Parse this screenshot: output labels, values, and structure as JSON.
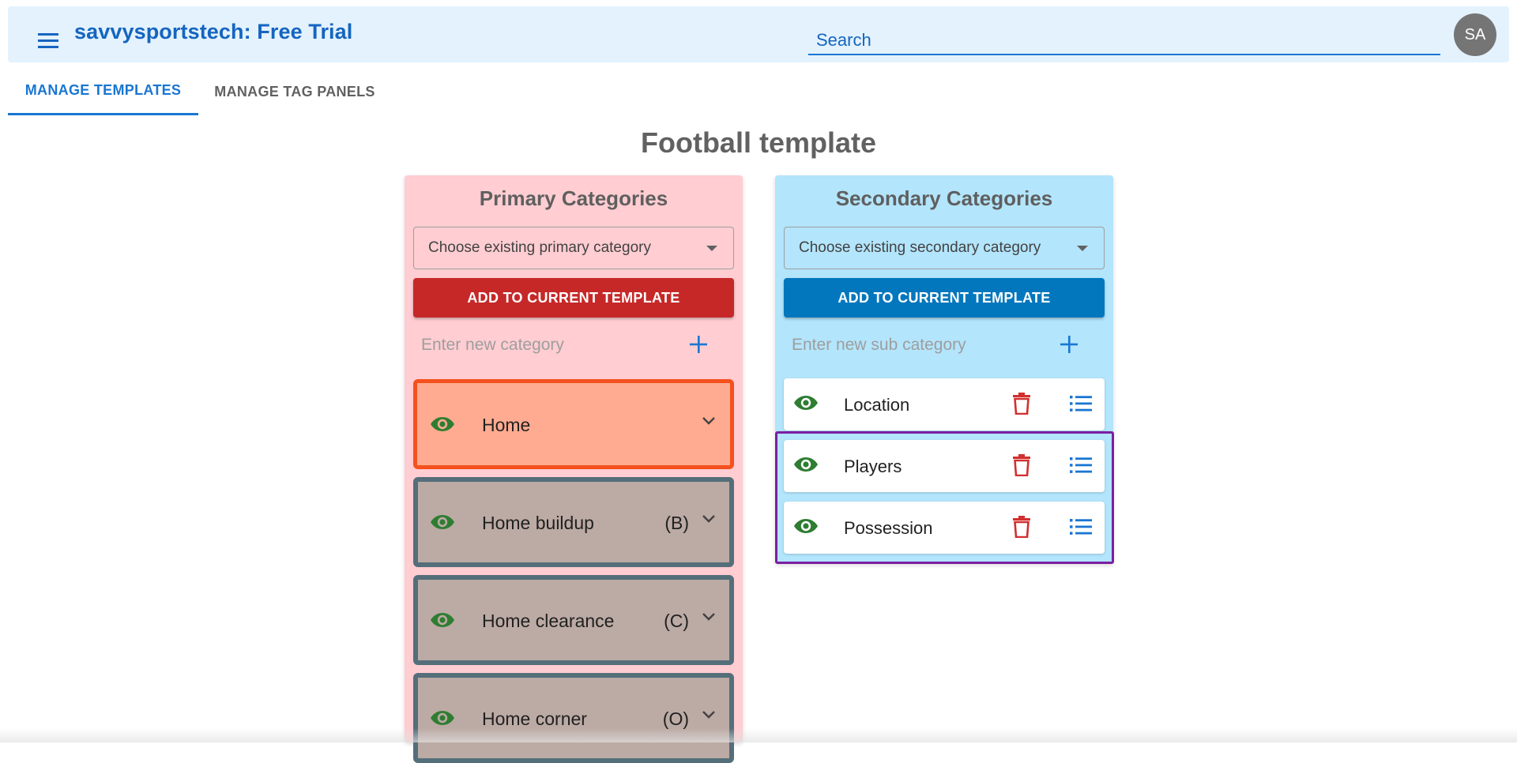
{
  "app": {
    "title": "savvysportstech: Free Trial",
    "search_placeholder": "Search",
    "avatar_initials": "SA"
  },
  "tabs": [
    {
      "label": "MANAGE TEMPLATES",
      "active": true
    },
    {
      "label": "MANAGE TAG PANELS",
      "active": false
    }
  ],
  "page_title": "Football template",
  "primary": {
    "heading": "Primary Categories",
    "select_placeholder": "Choose existing primary category",
    "add_button": "ADD TO CURRENT TEMPLATE",
    "new_placeholder": "Enter new category",
    "categories": [
      {
        "label": "Home",
        "hotkey": "",
        "selected": true
      },
      {
        "label": "Home buildup",
        "hotkey": "(B)"
      },
      {
        "label": "Home clearance",
        "hotkey": "(C)"
      },
      {
        "label": "Home corner",
        "hotkey": "(O)"
      }
    ]
  },
  "secondary": {
    "heading": "Secondary Categories",
    "select_placeholder": "Choose existing secondary category",
    "add_button": "ADD TO CURRENT TEMPLATE",
    "new_placeholder": "Enter new sub category",
    "items": [
      {
        "label": "Location"
      },
      {
        "label": "Players"
      },
      {
        "label": "Possession"
      }
    ]
  },
  "colors": {
    "appbar_bg": "#e3f2fd",
    "accent_blue": "#1976d2",
    "primary_panel_bg": "#ffcdd2",
    "secondary_panel_bg": "#b3e5fc",
    "add_red": "#c62828",
    "add_blue": "#0277bd",
    "selected_card_bg": "#ffab91",
    "selected_card_border": "#f4511e",
    "card_bg": "#bcaaa4",
    "card_border": "#546e7a",
    "eye_green": "#2e7d32",
    "trash_red": "#d32f2f",
    "selection_purple": "#7b1fa2"
  },
  "icons": {
    "menu": "menu-icon",
    "visible": "eye-icon",
    "expand": "chevron-down-icon",
    "delete": "trash-icon",
    "list": "list-icon",
    "add": "plus-icon"
  }
}
